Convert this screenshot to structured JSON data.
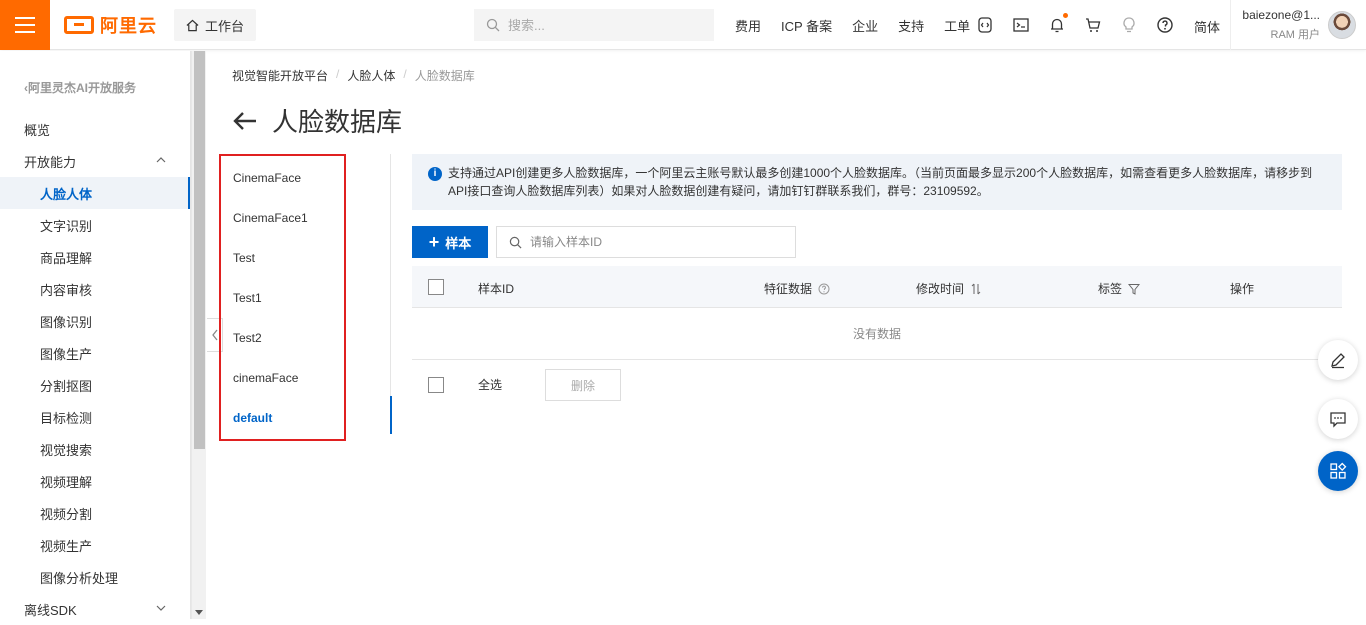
{
  "topbar": {
    "logo_text": "阿里云",
    "workbench": "工作台",
    "search_placeholder": "搜索...",
    "links": [
      "费用",
      "ICP 备案",
      "企业",
      "支持",
      "工单"
    ],
    "language": "简体",
    "user_name": "baiezone@1...",
    "user_role": "RAM 用户",
    "accent_color": "#ff6a00"
  },
  "sidebar": {
    "back_label": "阿里灵杰AI开放服务",
    "overview": "概览",
    "open_capability": "开放能力",
    "items": [
      "人脸人体",
      "文字识别",
      "商品理解",
      "内容审核",
      "图像识别",
      "图像生产",
      "分割抠图",
      "目标检测",
      "视觉搜索",
      "视频理解",
      "视频分割",
      "视频生产",
      "图像分析处理"
    ],
    "active_item": "人脸人体",
    "offline_sdk": "离线SDK"
  },
  "breadcrumb": [
    "视觉智能开放平台",
    "人脸人体",
    "人脸数据库"
  ],
  "page_title": "人脸数据库",
  "databases": [
    "CinemaFace",
    "CinemaFace1",
    "Test",
    "Test1",
    "Test2",
    "cinemaFace",
    "default"
  ],
  "active_database": "default",
  "notice": "支持通过API创建更多人脸数据库，一个阿里云主账号默认最多创建1000个人脸数据库。（当前页面最多显示200个人脸数据库，如需查看更多人脸数据库，请移步到API接口查询人脸数据库列表）如果对人脸数据创建有疑问，请加钉钉群联系我们，群号：23109592。",
  "toolbar": {
    "add_label": "样本",
    "search_placeholder": "请输入样本ID"
  },
  "table": {
    "columns": [
      "样本ID",
      "特征数据",
      "修改时间",
      "标签",
      "操作"
    ],
    "empty_text": "没有数据",
    "select_all": "全选",
    "delete_label": "删除"
  },
  "primary_color": "#0064c8"
}
